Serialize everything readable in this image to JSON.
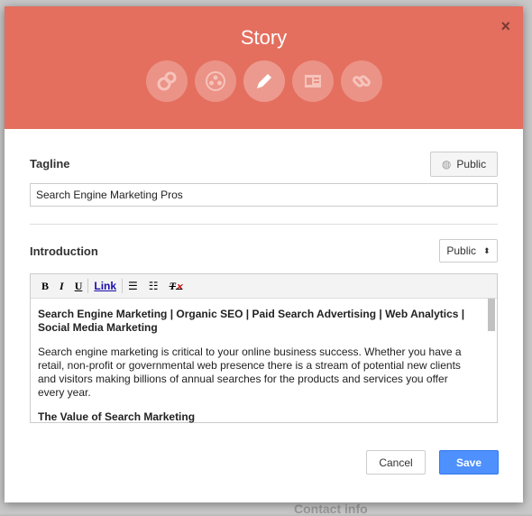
{
  "background": {
    "contact_info": "Contact info"
  },
  "modal": {
    "title": "Story",
    "close": "×",
    "icons": [
      "circles-icon",
      "group-icon",
      "pencil-icon",
      "profile-card-icon",
      "link-icon"
    ],
    "tagline": {
      "label": "Tagline",
      "visibility": "Public",
      "value": "Search Engine Marketing Pros"
    },
    "introduction": {
      "label": "Introduction",
      "visibility": "Public",
      "toolbar": {
        "bold": "B",
        "italic": "I",
        "underline": "U",
        "link": "Link"
      },
      "heading": "Search Engine Marketing | Organic SEO | Paid Search Advertising | Web Analytics | Social Media Marketing",
      "paragraph": "Search engine marketing is critical to your online business success. Whether you have a retail, non-profit or governmental web presence there is a stream of potential new clients and visitors making billions of annual searches for the products and services you offer every year.",
      "subheading": "The Value of Search Marketing"
    },
    "cancel": "Cancel",
    "save": "Save",
    "colors": {
      "header": "#e46f5f",
      "save": "#4d90fe"
    }
  }
}
